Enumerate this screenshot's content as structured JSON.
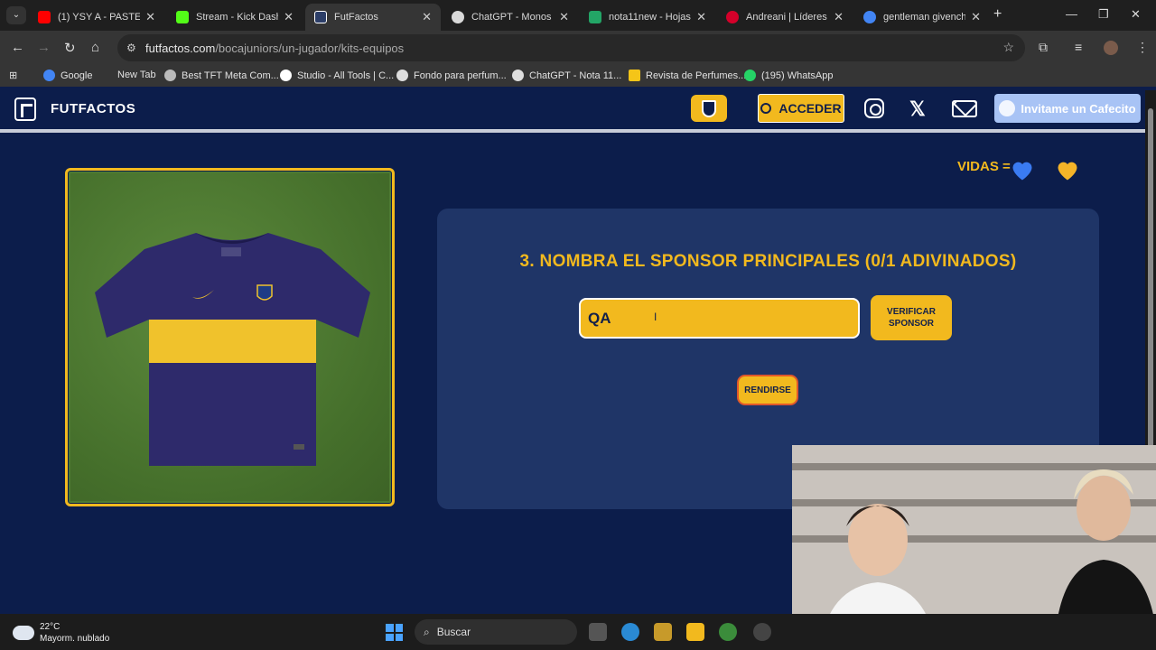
{
  "browser": {
    "tabs": [
      {
        "label": "(1) YSY A - PASTE",
        "color": "#ff0000"
      },
      {
        "label": "Stream - Kick Dashbo",
        "color": "#53fc18"
      },
      {
        "label": "FutFactos",
        "color": "#2c3e68",
        "active": true
      },
      {
        "label": "ChatGPT - Monos en",
        "color": "#d9d9d9"
      },
      {
        "label": "nota11new - Hojas d",
        "color": "#23a566"
      },
      {
        "label": "Andreani | Líderes en",
        "color": "#d4002a"
      },
      {
        "label": "gentleman givenchy",
        "color": "#4285f4"
      }
    ],
    "url_host": "futfactos.com",
    "url_path": "/bocajuniors/un-jugador/kits-equipos",
    "bookmarks": [
      {
        "label": "Google",
        "color": "#4285f4"
      },
      {
        "label": "New Tab",
        "color": ""
      },
      {
        "label": "Best TFT Meta Com...",
        "color": "#bbbbbb"
      },
      {
        "label": "Studio - All Tools | C...",
        "color": "#ffffff"
      },
      {
        "label": "Fondo para perfum...",
        "color": "#dddddd"
      },
      {
        "label": "ChatGPT - Nota 11...",
        "color": "#dddddd"
      },
      {
        "label": "Revista de Perfumes...",
        "color": "#f5c518"
      },
      {
        "label": "(195) WhatsApp",
        "color": "#25d366"
      }
    ]
  },
  "site": {
    "logo": "FUTFACTOS",
    "acceder": "ACCEDER",
    "x_icon": "𝕏",
    "cafecito": "Invitame un Cafecito",
    "vidas": "VIDAS =",
    "hearts": [
      "blue-heart",
      "gold-heart"
    ]
  },
  "game": {
    "question": "3. NOMBRA EL SPONSOR PRINCIPALES (0/1 ADIVINADOS)",
    "input_value": "QA",
    "verify_label_1": "VERIFICAR",
    "verify_label_2": "SPONSOR",
    "surrender": "RENDIRSE"
  },
  "taskbar": {
    "temperature": "22°C",
    "weather": "Mayorm. nublado",
    "search": "Buscar"
  },
  "colors": {
    "page_bg": "#0c1d4b",
    "panel_bg": "#1f3567",
    "accent": "#f2b91e"
  }
}
